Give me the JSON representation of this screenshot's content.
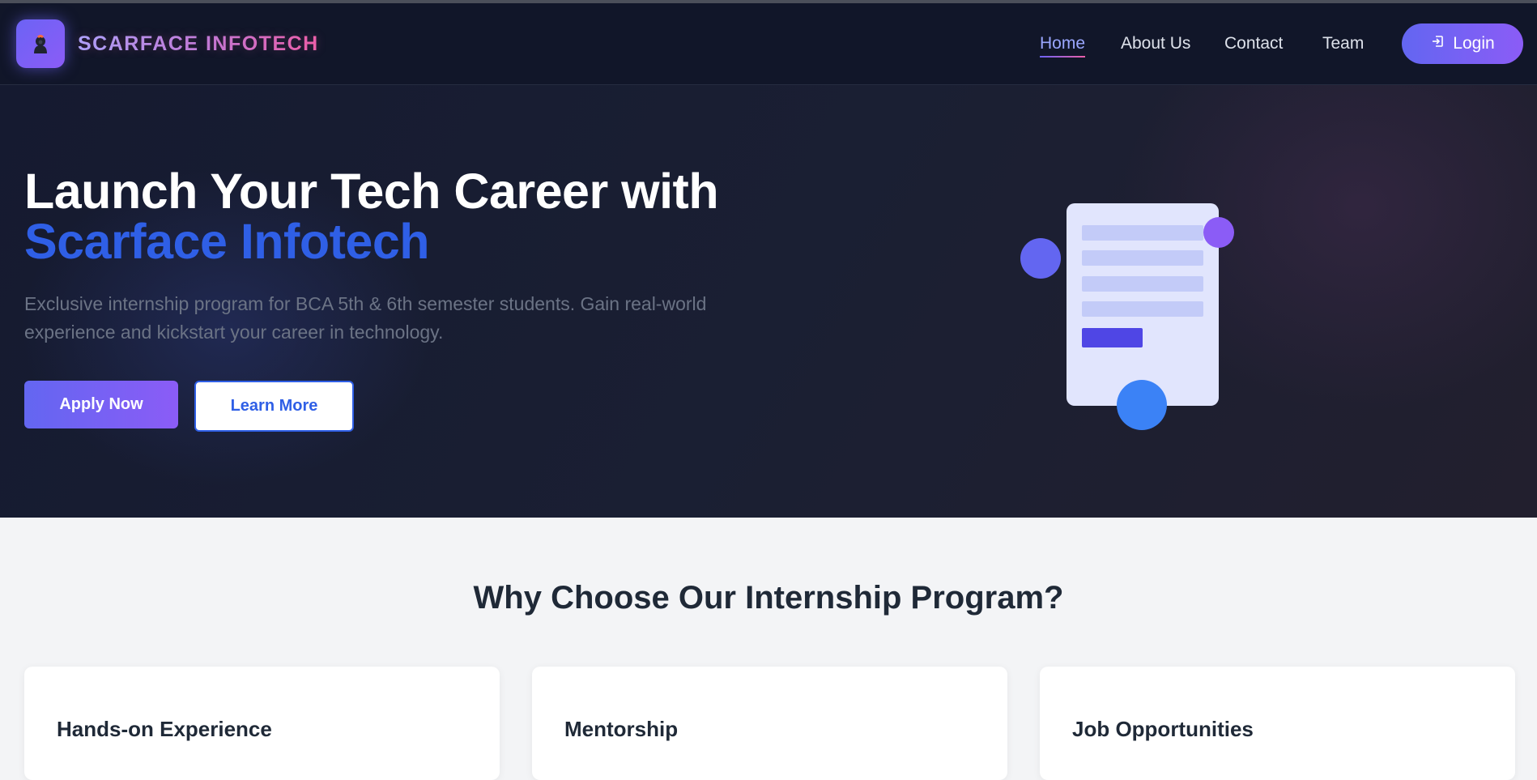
{
  "brand": {
    "name": "SCARFACE INFOTECH",
    "logo_icon": "hacker-icon"
  },
  "nav": {
    "links": [
      "Home",
      "About Us",
      "Contact",
      "Team"
    ],
    "active": "Home",
    "login_label": "Login",
    "login_icon": "login-icon"
  },
  "hero": {
    "title_line1": "Launch Your Tech Career with",
    "title_line2": "Scarface Infotech",
    "description": "Exclusive internship program for BCA 5th & 6th semester students. Gain real-world experience and kickstart your career in technology.",
    "apply_label": "Apply Now",
    "learn_label": "Learn More",
    "illustration_icon": "document-illustration"
  },
  "features": {
    "title": "Why Choose Our Internship Program?",
    "cards": [
      {
        "title": "Hands-on Experience"
      },
      {
        "title": "Mentorship"
      },
      {
        "title": "Job Opportunities"
      }
    ]
  },
  "colors": {
    "nav_bg": "#111629",
    "accent_purple": "#6366f1",
    "accent_blue": "#2f5fe6",
    "accent_pink": "#ec5fa8"
  }
}
